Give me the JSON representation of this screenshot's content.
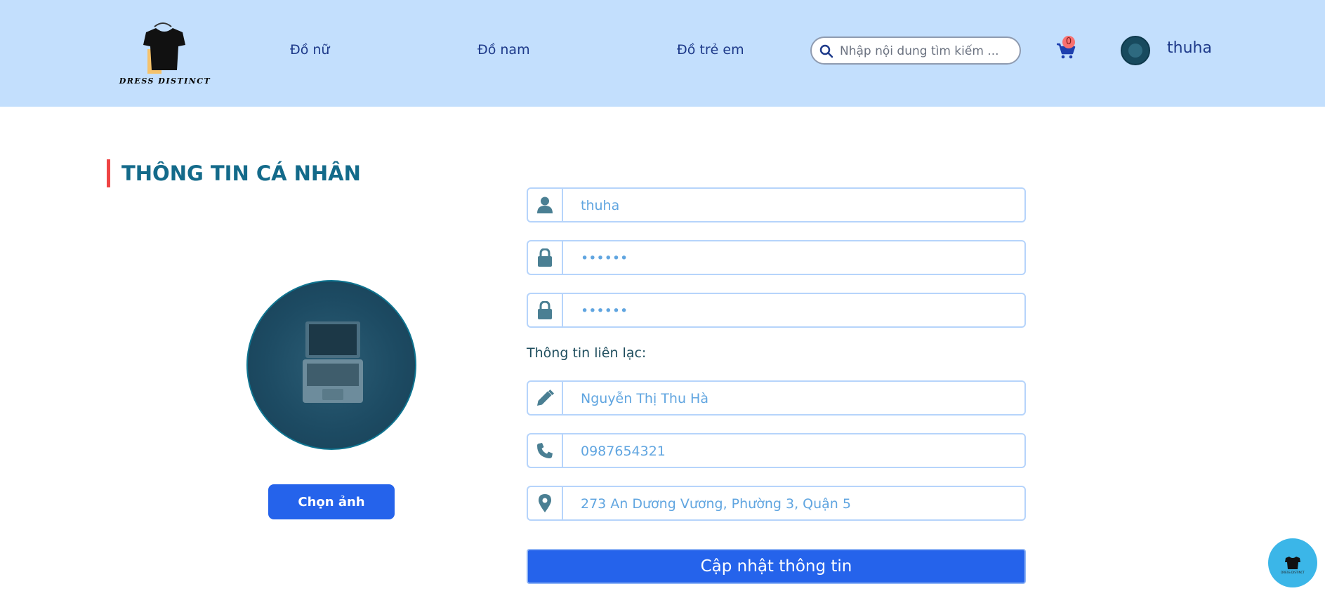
{
  "header": {
    "logo_text": "DRESS DISTINCT",
    "nav": [
      {
        "label": "Đồ nữ"
      },
      {
        "label": "Đồ nam"
      },
      {
        "label": "Đồ trẻ em"
      }
    ],
    "search_placeholder": "Nhập nội dung tìm kiếm ...",
    "cart_count": "0",
    "username": "thuha"
  },
  "profile": {
    "title": "THÔNG TIN CÁ NHÂN",
    "choose_image_label": "Chọn ảnh",
    "username_value": "thuha",
    "password_value": "••••••",
    "confirm_password_value": "••••••",
    "contact_label": "Thông tin liên lạc:",
    "fullname_value": "Nguyễn Thị Thu Hà",
    "phone_value": "0987654321",
    "address_value": "273 An Dương Vương, Phường 3, Quận 5",
    "update_label": "Cập nhật thông tin"
  },
  "chat_fab": {
    "mini_text": "DRESS DISTINCT"
  },
  "colors": {
    "header_bg": "#c3dffd",
    "primary": "#2563eb",
    "title": "#136a8a",
    "accent_bar": "#ef4444",
    "field_border": "#b6d4fb",
    "icon": "#4a7f93"
  },
  "icons": [
    "search-icon",
    "cart-icon",
    "user-icon",
    "lock-icon",
    "pencil-icon",
    "phone-icon",
    "location-pin-icon"
  ]
}
